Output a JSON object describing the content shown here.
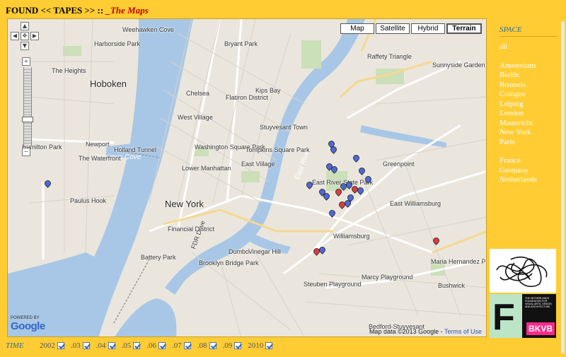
{
  "header": {
    "title": "FOUND << TAPES >> :: ",
    "subtitle": "_The Maps"
  },
  "map": {
    "types": [
      {
        "label": "Map",
        "active": false
      },
      {
        "label": "Satellite",
        "active": false
      },
      {
        "label": "Hybrid",
        "active": false
      },
      {
        "label": "Terrain",
        "active": true
      }
    ],
    "attribution": "Map data ©2013 Google - ",
    "terms": "Terms of Use",
    "powered_by": "POWERED BY",
    "logo": "Google",
    "labels": {
      "new_york": "New York",
      "hoboken": "Hoboken",
      "east_village": "East Village",
      "greenpoint": "Greenpoint",
      "williamsburg": "Williamsburg",
      "lower_manhattan": "Lower Manhattan",
      "financial_district": "Financial District",
      "battery_park": "Battery Park",
      "east_river_park": "East River State Park",
      "east_williamsburg": "East Williamsburg",
      "dumbo": "Dumbo",
      "steuben_playground": "Steuben Playground",
      "bedford_stuyvesant": "Bedford-Stuyvesant",
      "washington_square": "Washington Square Park",
      "harborside": "Harborside Park",
      "weehawken": "Weehawken Cove",
      "hamilton_park": "Hamilton Park",
      "maria_hernandez": "Maria Hernandez Park",
      "astoria_park": "Sunnyside Garden Park",
      "east_river": "East River",
      "hudson": "Harsimus Cove",
      "holland_tunnel": "Holland Tunnel",
      "fdr": "FDR Drive",
      "kips_bay": "Kips Bay",
      "flatiron": "Flatiron District",
      "chelsea": "Chelsea",
      "west_village": "West Village",
      "tompkins": "Tompkins Square Park",
      "stuyvesant": "Stuyvesant Town",
      "marcy": "Marcy Playground",
      "brooklyn_bridge": "Brooklyn Bridge Park",
      "vinegar_hill": "Vinegar Hill",
      "the_heights": "The Heights",
      "the_waterfront": "The Waterfront",
      "paulus_hook": "Paulus Hook",
      "newport": "Newport",
      "bryant_park": "Bryant Park",
      "raffety": "Raffety Triangle",
      "bushwick": "Bushwick"
    }
  },
  "time": {
    "label": "TIME",
    "years": [
      {
        "label": "2002",
        "checked": true
      },
      {
        "label": ".03",
        "checked": true
      },
      {
        "label": ".04",
        "checked": true
      },
      {
        "label": ".05",
        "checked": true
      },
      {
        "label": ".06",
        "checked": true
      },
      {
        "label": ".07",
        "checked": true
      },
      {
        "label": ".08",
        "checked": true
      },
      {
        "label": ".09",
        "checked": true
      },
      {
        "label": "2010",
        "checked": true
      }
    ]
  },
  "space": {
    "title": "SPACE",
    "all": "all",
    "cities": [
      "Amsterdam",
      "Berlin",
      "Brussels",
      "Cologne",
      "Leipzig",
      "London",
      "Maastricht",
      "New York",
      "Paris"
    ],
    "countries": [
      "France",
      "Germany",
      "Netherlands"
    ]
  },
  "sponsor": {
    "letter": "F",
    "small_text": "THE NETHERLANDS FOUNDATION FOR VISUAL ARTS, DESIGN AND ARCHITECTURE",
    "name": "BKVB"
  },
  "colors": {
    "background": "#ffcc33",
    "water": "#a8c7e6",
    "pin_blue": "#4d6adb",
    "pin_red": "#e23b3b"
  }
}
